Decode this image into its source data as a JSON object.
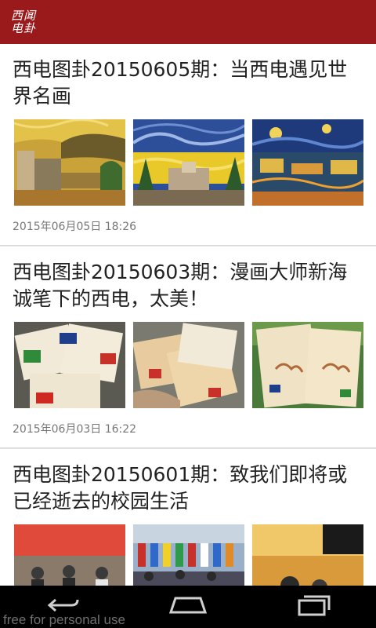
{
  "header": {
    "logo_text": "西闻电卦",
    "brand_color": "#9a1a1c"
  },
  "feed": {
    "articles": [
      {
        "title": "西电图卦20150605期：当西电遇见世界名画",
        "date": "2015年06月05日 18:26",
        "images": [
          "van-gogh-style-campus-1",
          "van-gogh-style-campus-2",
          "van-gogh-style-starry-night-campus"
        ]
      },
      {
        "title": "西电图卦20150603期：漫画大师新海诚笔下的西电，太美！",
        "date": "2015年06月03日 16:22",
        "images": [
          "illustrated-booklets-flags",
          "passport-booklets",
          "booklet-in-hand"
        ]
      },
      {
        "title": "西电图卦20150601期：致我们即将或已经逝去的校园生活",
        "date": "",
        "images": [
          "international-festival-stage",
          "flags-crowd",
          "festival-banner-photo"
        ]
      }
    ]
  },
  "navbar": {
    "back_icon": "back-icon",
    "home_icon": "home-icon",
    "recents_icon": "recent-apps-icon"
  },
  "watermark": "free for personal use"
}
